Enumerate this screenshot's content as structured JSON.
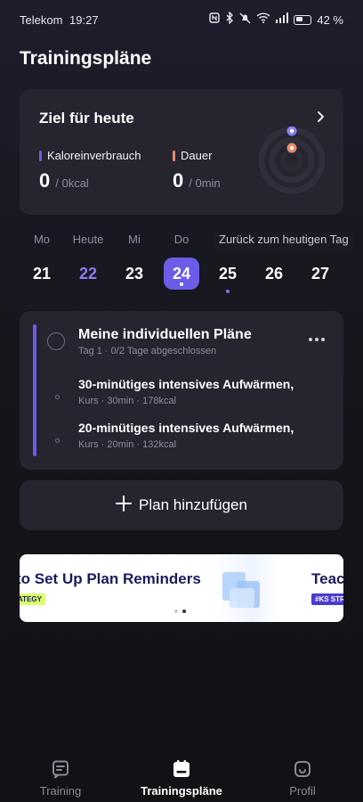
{
  "status_bar": {
    "carrier": "Telekom",
    "time": "19:27",
    "battery": "42 %"
  },
  "page_title": "Trainingspläne",
  "goal": {
    "title": "Ziel für heute",
    "calories": {
      "label": "Kaloreinverbrauch",
      "value": "0",
      "unit": "/ 0kcal",
      "color": "#6c5ce7"
    },
    "duration": {
      "label": "Dauer",
      "value": "0",
      "unit": "/ 0min",
      "color": "#e98a6a"
    }
  },
  "week": {
    "back_to_today": "Zurück zum heutigen Tag",
    "days": [
      {
        "name": "Mo",
        "num": "21"
      },
      {
        "name": "Heute",
        "num": "22"
      },
      {
        "name": "Mi",
        "num": "23"
      },
      {
        "name": "Do",
        "num": "24"
      },
      {
        "name": "",
        "num": "25"
      },
      {
        "name": "",
        "num": "26"
      },
      {
        "name": "",
        "num": "27"
      }
    ]
  },
  "plans": {
    "title": "Meine individuellen Pläne",
    "subtitle": "Tag 1 · 0/2 Tage abgeschlossen",
    "workouts": [
      {
        "title": "30-minütiges intensives Aufwärmen,",
        "meta": "Kurs · 30min · 178kcal"
      },
      {
        "title": "20-minütiges intensives Aufwärmen,",
        "meta": "Kurs · 20min · 132kcal"
      }
    ]
  },
  "add_plan_label": "Plan hinzufügen",
  "banner": {
    "text": "to Set Up Plan Reminders",
    "tag": "ATEGY",
    "text2": "Teac",
    "tag2": "#KS STR"
  },
  "nav": {
    "items": [
      {
        "label": "Training",
        "icon": "training-icon"
      },
      {
        "label": "Trainingspläne",
        "icon": "plans-icon"
      },
      {
        "label": "Profil",
        "icon": "profile-icon"
      }
    ],
    "active": "Trainingspläne"
  },
  "colors": {
    "accent": "#6c5ce7",
    "card_bg": "#25242f",
    "duration": "#e98a6a"
  }
}
